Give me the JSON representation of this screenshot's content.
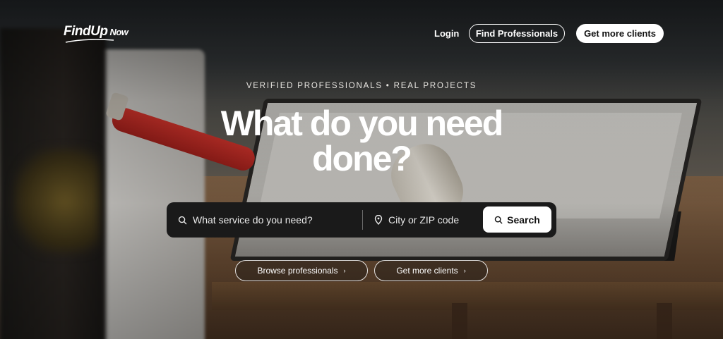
{
  "brand": {
    "logo_main": "FindUp",
    "logo_sub": "Now"
  },
  "nav": {
    "login_label": "Login",
    "find_professionals_label": "Find Professionals",
    "get_more_clients_label": "Get more clients"
  },
  "hero": {
    "eyebrow": "VERIFIED PROFESSIONALS • REAL PROJECTS",
    "headline": "What do you need done?"
  },
  "search": {
    "service_placeholder": "What service do you need?",
    "location_placeholder": "City or ZIP code",
    "button_label": "Search",
    "icons": {
      "service": "search-icon",
      "location": "map-pin-icon",
      "button": "search-icon"
    }
  },
  "actions": {
    "browse_label": "Browse professionals",
    "more_clients_label": "Get more clients",
    "arrow_glyph": "›"
  },
  "colors": {
    "search_bar_bg": "#1a1a1a",
    "primary_button_bg": "#ffffff",
    "text": "#ffffff"
  }
}
